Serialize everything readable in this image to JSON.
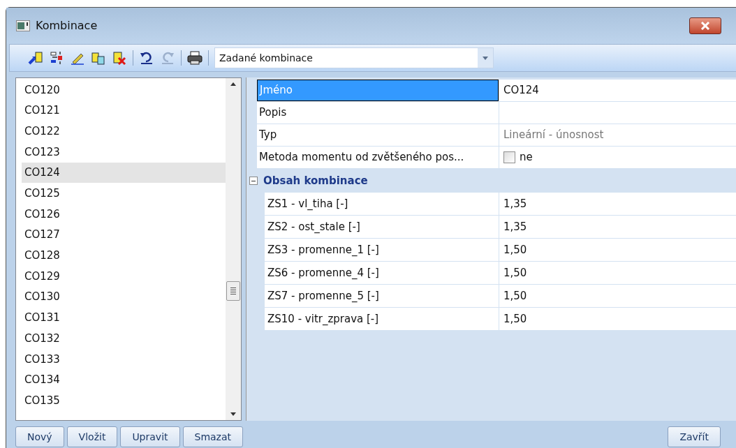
{
  "window": {
    "title": "Kombinace"
  },
  "toolbar": {
    "combo": {
      "value": "Zadané kombinace"
    }
  },
  "list": {
    "items": [
      {
        "label": "CO120",
        "selected": false
      },
      {
        "label": "CO121",
        "selected": false
      },
      {
        "label": "CO122",
        "selected": false
      },
      {
        "label": "CO123",
        "selected": false
      },
      {
        "label": "CO124",
        "selected": true
      },
      {
        "label": "CO125",
        "selected": false
      },
      {
        "label": "CO126",
        "selected": false
      },
      {
        "label": "CO127",
        "selected": false
      },
      {
        "label": "CO128",
        "selected": false
      },
      {
        "label": "CO129",
        "selected": false
      },
      {
        "label": "CO130",
        "selected": false
      },
      {
        "label": "CO131",
        "selected": false
      },
      {
        "label": "CO132",
        "selected": false
      },
      {
        "label": "CO133",
        "selected": false
      },
      {
        "label": "CO134",
        "selected": false
      },
      {
        "label": "CO135",
        "selected": false
      }
    ]
  },
  "properties": [
    {
      "kind": "text",
      "label": "Jméno",
      "value": "CO124",
      "selected": true
    },
    {
      "kind": "text",
      "label": "Popis",
      "selected": false
    },
    {
      "kind": "readonly",
      "label": "Typ",
      "value": "Lineární - únosnost",
      "selected": false
    },
    {
      "kind": "checkbox",
      "label": "Metoda momentu od zvětšeného pos...",
      "value": "ne",
      "checked": false,
      "selected": false
    }
  ],
  "category": {
    "title": "Obsah kombinace",
    "expanded": true,
    "rows": [
      {
        "label": "ZS1 - vl_tiha [-]",
        "value": "1,35"
      },
      {
        "label": "ZS2 - ost_stale [-]",
        "value": "1,35"
      },
      {
        "label": "ZS3 - promenne_1 [-]",
        "value": "1,50"
      },
      {
        "label": "ZS6 - promenne_4 [-]",
        "value": "1,50"
      },
      {
        "label": "ZS7 - promenne_5 [-]",
        "value": "1,50"
      },
      {
        "label": "ZS10 - vitr_zprava [-]",
        "value": "1,50"
      }
    ]
  },
  "buttons": [
    "Nový",
    "Vložit",
    "Upravit",
    "Smazat"
  ],
  "close_button": "Zavřít"
}
